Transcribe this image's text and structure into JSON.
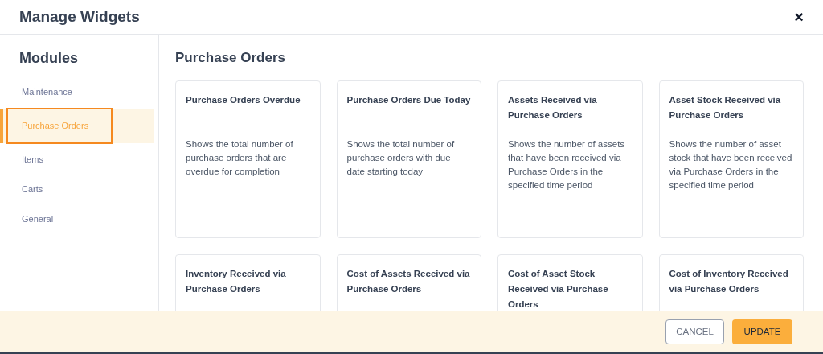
{
  "window": {
    "title": "Manage Widgets",
    "close": "×"
  },
  "sidebar": {
    "title": "Modules",
    "items": [
      {
        "label": "Maintenance",
        "selected": false
      },
      {
        "label": "Purchase Orders",
        "selected": true
      },
      {
        "label": "Items",
        "selected": false
      },
      {
        "label": "Carts",
        "selected": false
      },
      {
        "label": "General",
        "selected": false
      }
    ]
  },
  "content": {
    "title": "Purchase Orders",
    "widgets": [
      {
        "title": "Purchase Orders Overdue",
        "description": "Shows the total number of purchase orders that are overdue for completion"
      },
      {
        "title": "Purchase Orders Due Today",
        "description": "Shows the total number of purchase orders with due date starting today"
      },
      {
        "title": "Assets Received via Purchase Orders",
        "description": "Shows the number of assets that have been received via Purchase Orders in the specified time period"
      },
      {
        "title": "Asset Stock Received via Purchase Orders",
        "description": "Shows the number of asset stock that have been received via Purchase Orders in the specified time period"
      },
      {
        "title": "Inventory Received via Purchase Orders"
      },
      {
        "title": "Cost of Assets Received via Purchase Orders"
      },
      {
        "title": "Cost of Asset Stock Received via Purchase Orders"
      },
      {
        "title": "Cost of Inventory Received via Purchase Orders"
      }
    ]
  },
  "buttons": [
    {
      "label": "CANCEL",
      "kind": "secondary"
    },
    {
      "label": "UPDATE",
      "kind": "primary"
    }
  ]
}
